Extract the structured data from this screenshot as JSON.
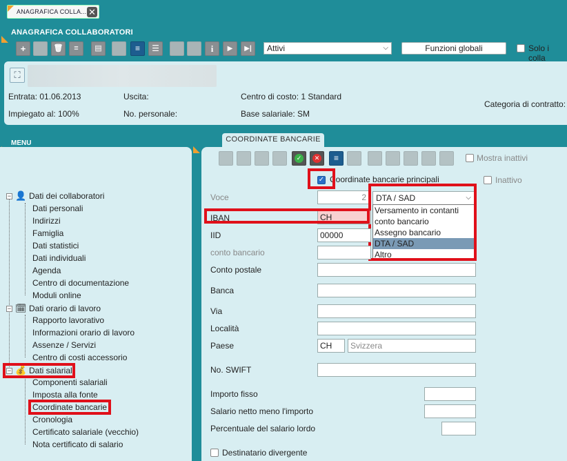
{
  "tab": {
    "label": "ANAGRAFICA COLLA...",
    "close": "✕"
  },
  "header": {
    "title": "ANAGRAFICA COLLABORATORI",
    "filter_value": "Attivi",
    "global_functions": "Funzioni globali",
    "only_label": "Solo i colla",
    "entry": "Entrata: 01.06.2013",
    "exit": "Uscita:",
    "cost_center": "Centro di costo: 1 Standard",
    "employed": "Impiegato al: 100%",
    "personnel_no": "No. personale:",
    "salary_base": "Base salariale: SM",
    "contract_category": "Categoria di contratto:"
  },
  "menu": {
    "title": "MENU",
    "groups": [
      {
        "label": "Dati dei collaboratori",
        "items": [
          "Dati personali",
          "Indirizzi",
          "Famiglia",
          "Dati statistici",
          "Dati individuali",
          "Agenda",
          "Centro di documentazione",
          "Moduli online"
        ]
      },
      {
        "label": "Dati orario di lavoro",
        "items": [
          "Rapporto lavorativo",
          "Informazioni orario di lavoro",
          "Assenze / Servizi",
          "Centro di costi accessorio"
        ]
      },
      {
        "label": "Dati salariali",
        "items": [
          "Componenti salariali",
          "Imposta alla fonte",
          "Coordinate bancarie",
          "Cronologia",
          "Certificato salariale (vecchio)",
          "Nota certificato di salario"
        ]
      }
    ]
  },
  "panel": {
    "tab": "COORDINATE BANCARIE",
    "show_inactive": "Mostra inattivi",
    "main_coordinates": "Coordinate bancarie principali",
    "inactive": "Inattivo",
    "voce_label": "Voce",
    "voce_value": "2",
    "type_value": "DTA / SAD",
    "type_options": [
      "Versamento in contanti",
      "conto bancario",
      "Assegno bancario",
      "DTA / SAD",
      "Altro"
    ],
    "iban_label": "IBAN",
    "iban_value": "CH",
    "iid_label": "IID",
    "iid_value": "00000",
    "conto_bancario": "conto bancario",
    "conto_postale": "Conto postale",
    "banca": "Banca",
    "via": "Via",
    "localita": "Località",
    "paese": "Paese",
    "paese_code": "CH",
    "paese_name": "Svizzera",
    "swift": "No. SWIFT",
    "importo_fisso": "Importo fisso",
    "salario_netto": "Salario netto meno l'importo",
    "percentuale": "Percentuale del salario lordo",
    "destinatario": "Destinatario divergente"
  },
  "colors": {
    "teal": "#1f8d99",
    "panel": "#d8eef2",
    "highlight": "#e0101a",
    "accent": "#f0a030"
  }
}
